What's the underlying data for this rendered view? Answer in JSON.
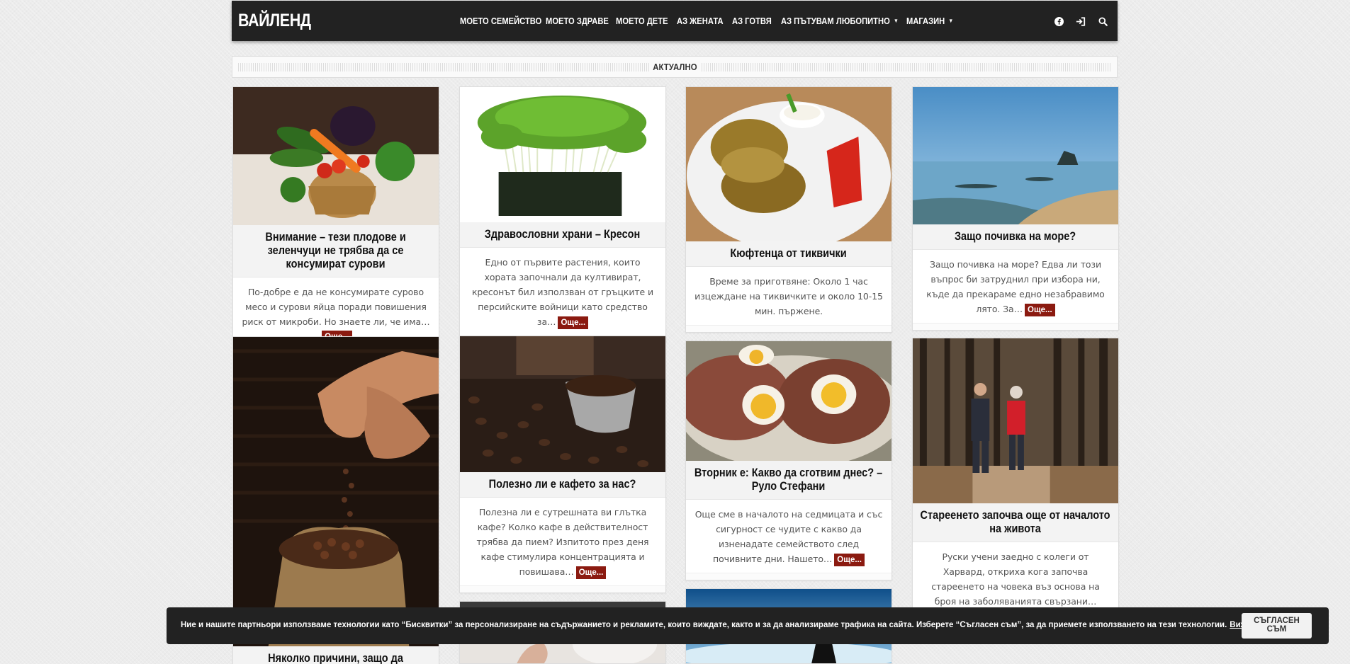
{
  "brand": "ВАЙЛЕНД",
  "menu": [
    {
      "label": "МОЕТО СЕМЕЙСТВО",
      "dropdown": false
    },
    {
      "label": "МОЕТО ЗДРАВЕ",
      "dropdown": false
    },
    {
      "label": "МОЕТО ДЕТЕ",
      "dropdown": false
    },
    {
      "label": "АЗ ЖЕНАТА",
      "dropdown": false
    },
    {
      "label": "АЗ ГОТВЯ",
      "dropdown": false
    },
    {
      "label": "АЗ ПЪТУВАМ",
      "dropdown": false
    },
    {
      "label": "ЛЮБОПИТНО",
      "dropdown": true
    },
    {
      "label": "МАГАЗИН",
      "dropdown": true
    }
  ],
  "nav_icons": [
    "facebook-icon",
    "login-icon",
    "search-icon"
  ],
  "section_title": "АКТУАЛНО",
  "more_label": "Още...",
  "cards": [
    {
      "title": "Внимание – тези плодове и зеленчуци не трябва да се консумират сурови",
      "excerpt": "По-добре е да не консумирате сурово месо и сурови яйца поради повишения риск от микроби.  Но знаете ли, че има…",
      "image": "vegetables-basket"
    },
    {
      "title": "Здравословни храни – Кресон",
      "excerpt": "Едно от първите растения, които хората започнали да култивират, кресонът бил използван от гръцките и персийските войници като средство за…",
      "image": "cress-sprouts"
    },
    {
      "title": "Кюфтенца от тиквички",
      "excerpt": "Време за приготвяне: Около 1 час изцеждане на тиквичките и около 10-15 мин. пържене.",
      "image": "zucchini-fritters"
    },
    {
      "title": "Защо почивка на море?",
      "excerpt": "Защо почивка на море? Едва ли този въпрос би затруднил при избора ни, къде да прекараме едно незабравимо лято. За…",
      "image": "seaside"
    },
    {
      "title": "Няколко причини, защо да",
      "excerpt": "",
      "image": "cocoa-beans-sack"
    },
    {
      "title": "Полезно ли е кафето за нас?",
      "excerpt": "Полезна ли е сутрешната ви глътка кафе? Колко кафе в действителност трябва да пием?   Изпитото през деня кафе стимулира концентрацията и повишава…",
      "image": "coffee-beans"
    },
    {
      "title": "Вторник е: Какво да сготвим днес? – Руло Стефани",
      "excerpt": "Още сме в началото на седмицата и със сигурност се чудите с какво да изненадате семейството след почивните дни. Нашето…",
      "image": "meatloaf-eggs"
    },
    {
      "title": "Стареенето започва още от началото на живота",
      "excerpt": "Руски учени заедно с колеги от Харвард, откриха кога започва стареенето на човека въз основа на броя на заболяванията свързани…",
      "image": "elderly-couple-forest"
    }
  ],
  "cookie": {
    "message": "Ние и нашите партньори използваме технологии като “Бисквитки” за персонализиране на съдържанието и рекламите, които виждате, както и за да анализираме трафика на сайта. Изберете “Съгласен съм”, за да приемете използването на тези технологии.",
    "link": "Вижте още",
    "button_line1": "СЪГЛАСЕН",
    "button_line2": "СЪМ"
  },
  "colors": {
    "nav_bg": "#222222",
    "more_button": "#8b1a10",
    "page_bg": "#ececec"
  }
}
